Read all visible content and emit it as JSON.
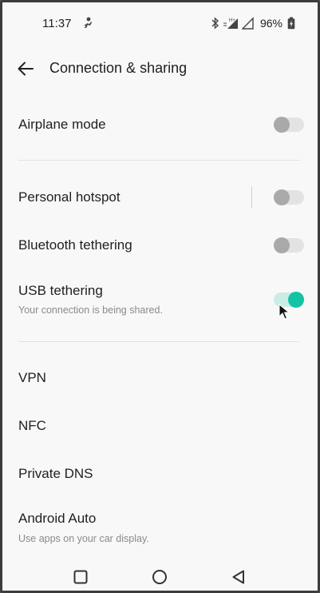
{
  "status_bar": {
    "time": "11:37",
    "notification_icon": "emoji-activity-icon",
    "bluetooth_icon": "bluetooth-icon",
    "network_type": "H+",
    "signal_icons": [
      "signal-icon",
      "signal-icon"
    ],
    "battery_percent": "96%",
    "battery_icon": "battery-charging-icon"
  },
  "header": {
    "back_icon": "arrow-left-icon",
    "title": "Connection & sharing"
  },
  "settings": {
    "airplane_mode": {
      "label": "Airplane mode",
      "enabled": false
    },
    "personal_hotspot": {
      "label": "Personal hotspot",
      "enabled": false
    },
    "bluetooth_tethering": {
      "label": "Bluetooth tethering",
      "enabled": false
    },
    "usb_tethering": {
      "label": "USB tethering",
      "subtitle": "Your connection is being shared.",
      "enabled": true
    },
    "vpn": {
      "label": "VPN"
    },
    "nfc": {
      "label": "NFC"
    },
    "private_dns": {
      "label": "Private DNS"
    },
    "android_auto": {
      "label": "Android Auto",
      "subtitle": "Use apps on your car display."
    }
  },
  "colors": {
    "accent": "#12c3a5",
    "toggle_track_on": "#c9ede6",
    "toggle_off": "#a9a9a9"
  },
  "nav_bar": {
    "recents_icon": "square-icon",
    "home_icon": "circle-icon",
    "back_icon": "triangle-back-icon"
  }
}
